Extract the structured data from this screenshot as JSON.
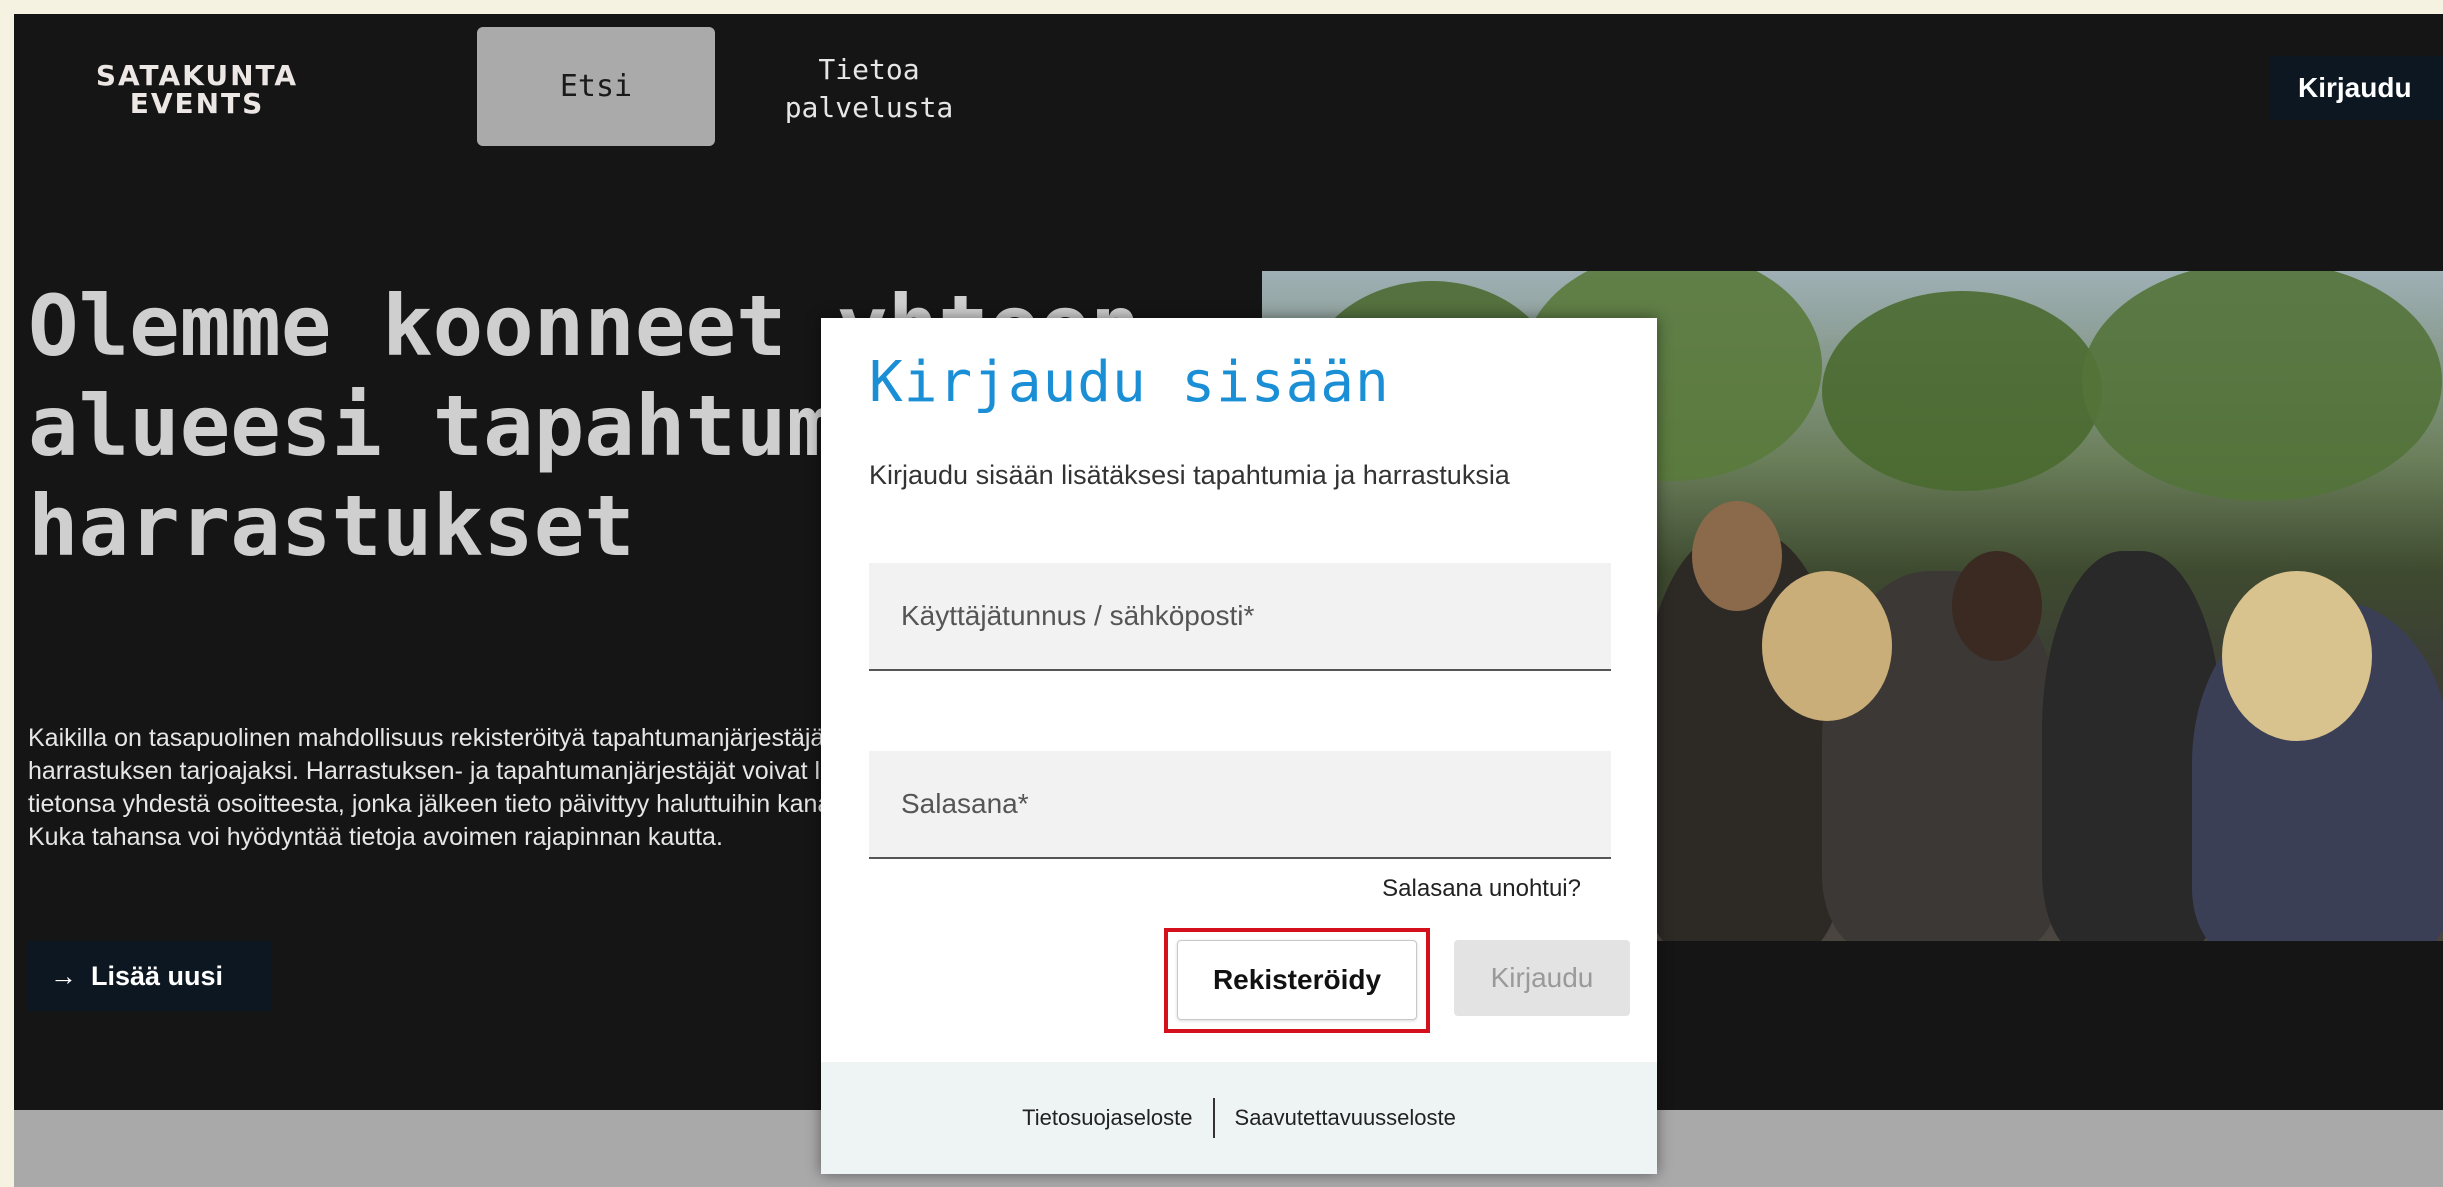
{
  "header": {
    "logo_line1": "SATAKUNTA",
    "logo_line2": "EVENTS",
    "nav_search": "Etsi",
    "nav_about": "Tietoa palvelusta",
    "login_button": "Kirjaudu"
  },
  "hero": {
    "title": "Olemme koonneet yhteen alueesi tapahtumat ja harrastukset",
    "description": "Kaikilla on tasapuolinen mahdollisuus rekisteröityä tapahtumanjärjestäjäksi tai harrastuksen tarjoajaksi. Harrastuksen- ja tapahtumanjärjestäjät voivat lisätä tietonsa yhdestä osoitteesta, jonka jälkeen tieto päivittyy haluttuihin kanaviin. Kuka tahansa voi hyödyntää tietoja avoimen rajapinnan kautta.",
    "add_new_icon": "arrow-right-icon",
    "add_new_label": "Lisää uusi"
  },
  "modal": {
    "title": "Kirjaudu sisään",
    "subtitle": "Kirjaudu sisään lisätäksesi tapahtumia ja harrastuksia",
    "username_placeholder": "Käyttäjätunnus / sähköposti*",
    "password_placeholder": "Salasana*",
    "forgot_password": "Salasana unohtui?",
    "register_label": "Rekisteröidy",
    "login_label": "Kirjaudu",
    "footer": {
      "privacy": "Tietosuojaseloste",
      "accessibility": "Saavutettavuusseloste"
    }
  },
  "colors": {
    "page_bg": "#151515",
    "accent_blue": "#1a8fd6",
    "highlight_red": "#d3101c",
    "dark_button": "#0c1722"
  }
}
